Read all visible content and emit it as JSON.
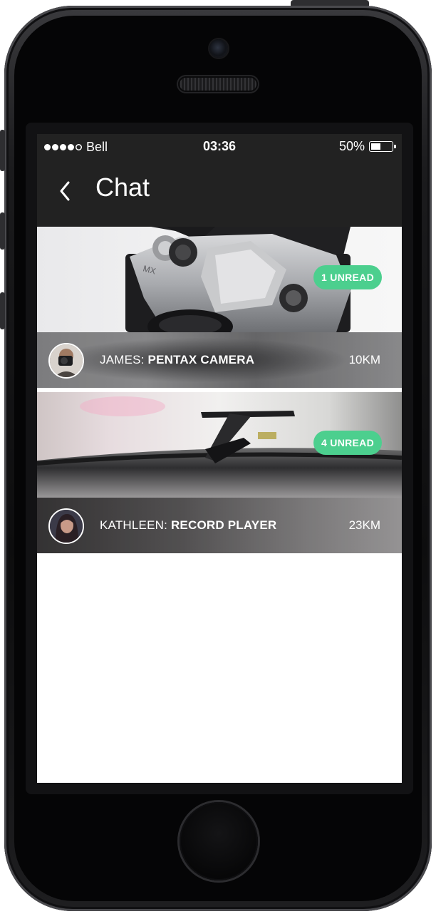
{
  "status_bar": {
    "signal": "●●●●○",
    "carrier": "Bell",
    "time": "03:36",
    "battery": "50%",
    "battery_level": 0.5
  },
  "nav": {
    "back_icon": "chevron-left-icon",
    "title": "Chat"
  },
  "chats": [
    {
      "sender": "JAMES:",
      "item": "PENTAX CAMERA",
      "distance": "10KM",
      "unread": "1 UNREAD"
    },
    {
      "sender": "KATHLEEN:",
      "item": "RECORD PLAYER",
      "distance": "23KM",
      "unread": "4 UNREAD"
    }
  ],
  "colors": {
    "bar": "#222222",
    "badge": "#4ccf8e",
    "text": "#ffffff"
  }
}
